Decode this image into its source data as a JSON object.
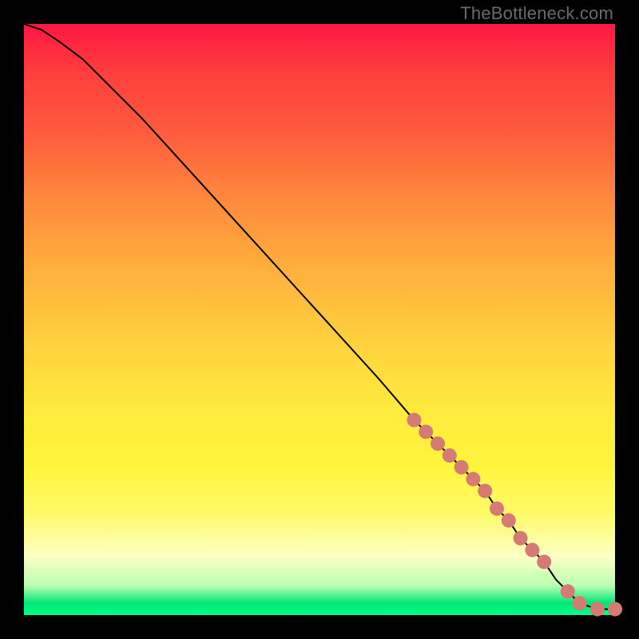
{
  "watermark": "TheBottleneck.com",
  "chart_data": {
    "type": "line",
    "title": "",
    "xlabel": "",
    "ylabel": "",
    "xlim": [
      0,
      100
    ],
    "ylim": [
      0,
      100
    ],
    "grid": false,
    "gradient": {
      "top_color": "#ff1744",
      "mid_color": "#ffea3d",
      "bottom_color": "#00ff8a"
    },
    "series": [
      {
        "name": "bottleneck-curve",
        "x": [
          0,
          3,
          6,
          10,
          15,
          20,
          30,
          40,
          50,
          60,
          66,
          68,
          70,
          72,
          74,
          76,
          78,
          80,
          82,
          84,
          86,
          88,
          90,
          92,
          94,
          97,
          100
        ],
        "y": [
          100,
          99,
          97,
          94,
          89,
          84,
          73,
          62,
          51,
          40,
          33,
          31,
          29,
          27,
          25,
          23,
          21,
          18,
          16,
          13,
          11,
          9,
          6,
          4,
          2,
          1,
          1
        ]
      }
    ],
    "highlight_points": {
      "name": "dots",
      "color": "#d67a74",
      "radius": 9,
      "x": [
        66,
        68,
        70,
        72,
        74,
        76,
        78,
        80,
        82,
        84,
        86,
        88,
        92,
        94,
        97,
        100
      ],
      "y": [
        33,
        31,
        29,
        27,
        25,
        23,
        21,
        18,
        16,
        13,
        11,
        9,
        4,
        2,
        1,
        1
      ]
    }
  }
}
